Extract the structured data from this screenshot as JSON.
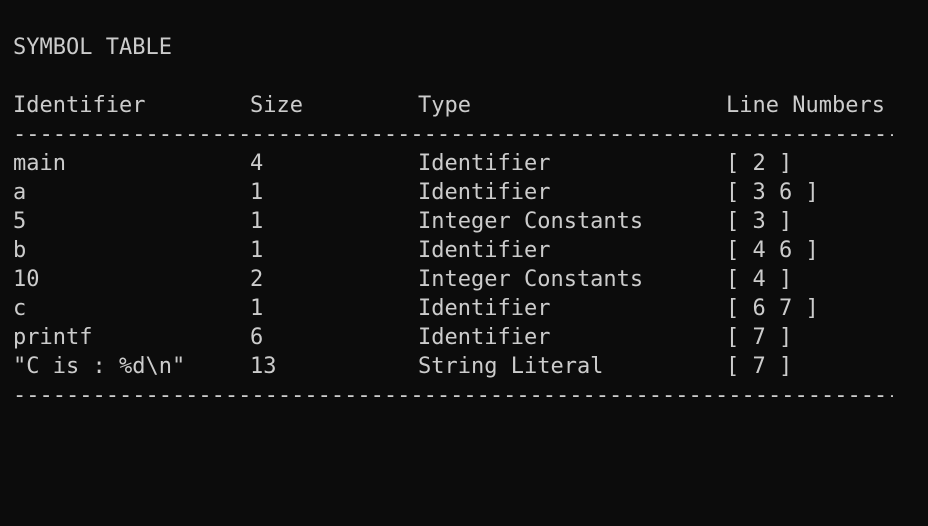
{
  "title": "SYMBOL TABLE",
  "headers": {
    "identifier": "Identifier",
    "size": "Size",
    "type": "Type",
    "line_numbers": "Line Numbers"
  },
  "separator": "--------------------------------------------------------------------------------",
  "rows": [
    {
      "identifier": "main",
      "size": "4",
      "type": "Identifier",
      "line_numbers": "[ 2 ]"
    },
    {
      "identifier": "a",
      "size": "1",
      "type": "Identifier",
      "line_numbers": "[ 3 6 ]"
    },
    {
      "identifier": "5",
      "size": "1",
      "type": "Integer Constants",
      "line_numbers": "[ 3 ]"
    },
    {
      "identifier": "b",
      "size": "1",
      "type": "Identifier",
      "line_numbers": "[ 4 6 ]"
    },
    {
      "identifier": "10",
      "size": "2",
      "type": "Integer Constants",
      "line_numbers": "[ 4 ]"
    },
    {
      "identifier": "c",
      "size": "1",
      "type": "Identifier",
      "line_numbers": "[ 6 7 ]"
    },
    {
      "identifier": "printf",
      "size": "6",
      "type": "Identifier",
      "line_numbers": "[ 7 ]"
    },
    {
      "identifier": "\"C is : %d\\n\"",
      "size": "13",
      "type": "String Literal",
      "line_numbers": "[ 7 ]"
    }
  ]
}
